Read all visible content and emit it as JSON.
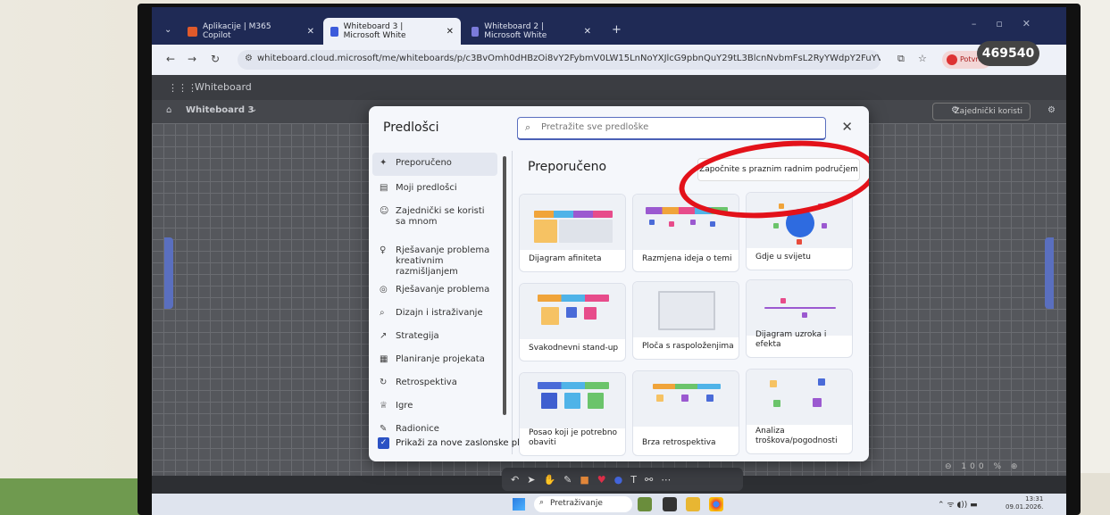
{
  "browser": {
    "tabs": [
      {
        "label": "Aplikacije | M365 Copilot",
        "icon_color": "#e05a2b"
      },
      {
        "label": "Whiteboard 3 | Microsoft White",
        "icon_color": "#3b5bdb"
      },
      {
        "label": "Whiteboard 2 | Microsoft White",
        "icon_color": "#7b7bdb"
      }
    ],
    "url": "whiteboard.cloud.microsoft/me/whiteboards/p/c3BvOmh0dHBzOi8vY2FybmV0LW15LnNoYXJlcG9pbnQuY29tL3BlcnNvbmFsL2RyYWdpY2FuYV9kZWdlbl9za29sYWRpZ2l0YWxuYWNyb2F0aWFfaHIvRG9jdW1lbnRz...",
    "potvrdi_label": "Potvrdi",
    "overlay_badge": "469540"
  },
  "app": {
    "name": "Whiteboard",
    "board_title": "Whiteboard 3",
    "share_label": "Zajednički koristi",
    "zoom_label": "100 %"
  },
  "dialog": {
    "title": "Predlošci",
    "search_placeholder": "Pretražite sve predloške",
    "nav": [
      {
        "label": "Preporučeno",
        "icon": "sparkle-icon"
      },
      {
        "label": "Moji predlošci",
        "icon": "folder-icon"
      },
      {
        "label": "Zajednički se koristi sa mnom",
        "icon": "people-icon"
      },
      {
        "label": "Rješavanje problema kreativnim razmišljanjem",
        "icon": "lightbulb-icon"
      },
      {
        "label": "Rješavanje problema",
        "icon": "puzzle-icon"
      },
      {
        "label": "Dizajn i istraživanje",
        "icon": "magnifier-icon"
      },
      {
        "label": "Strategija",
        "icon": "chart-icon"
      },
      {
        "label": "Planiranje projekata",
        "icon": "calendar-icon"
      },
      {
        "label": "Retrospektiva",
        "icon": "loop-icon"
      },
      {
        "label": "Igre",
        "icon": "trophy-icon"
      },
      {
        "label": "Radionice",
        "icon": "pen-icon"
      }
    ],
    "show_on_new_label": "Prikaži za nove zaslonske ploče",
    "section_title": "Preporučeno",
    "start_blank_label": "Započnite s praznim radnim područjem",
    "templates": [
      {
        "label": "Dijagram afiniteta"
      },
      {
        "label": "Razmjena ideja o temi"
      },
      {
        "label": "Gdje u svijetu"
      },
      {
        "label": "Svakodnevni stand-up"
      },
      {
        "label": "Ploča s raspoloženjima"
      },
      {
        "label": "Dijagram uzroka i efekta"
      },
      {
        "label": "Posao koji je potrebno obaviti"
      },
      {
        "label": "Brza retrospektiva"
      },
      {
        "label": "Analiza troškova/pogodnosti"
      }
    ]
  },
  "taskbar": {
    "search_label": "Pretraživanje",
    "time": "13:31",
    "date": "09.01.2026."
  },
  "colors": {
    "accent": "#2b52c4",
    "annotation_red": "#e3121a",
    "tabbar": "#1f2a55"
  }
}
